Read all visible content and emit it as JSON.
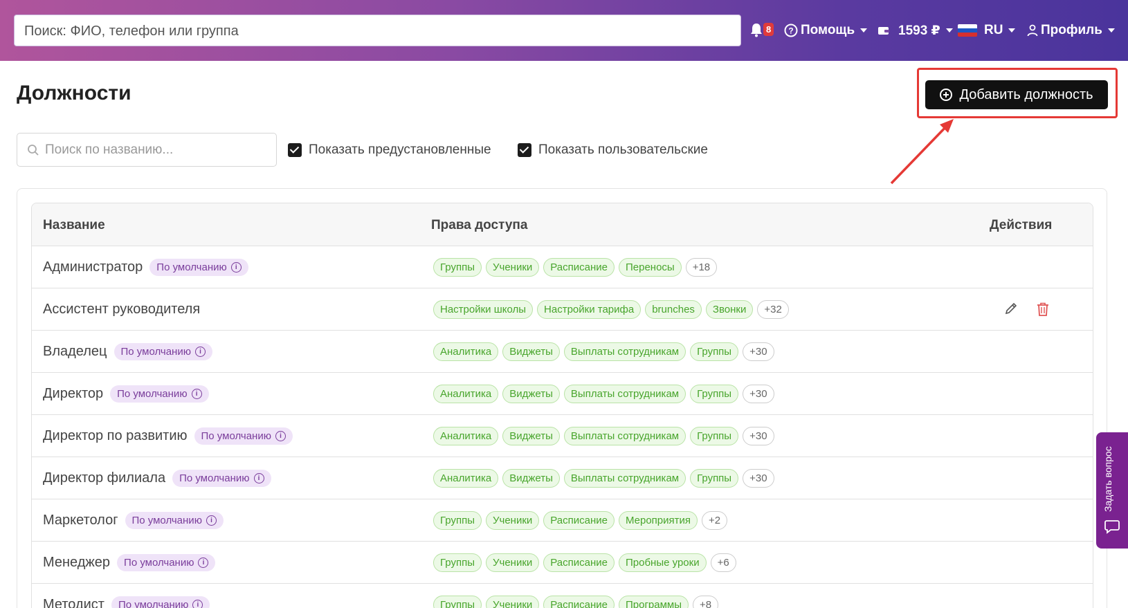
{
  "header": {
    "search_placeholder": "Поиск: ФИО, телефон или группа",
    "notifications_count": "8",
    "help_label": "Помощь",
    "balance": "1593 ₽",
    "language": "RU",
    "profile_label": "Профиль"
  },
  "page": {
    "title": "Должности",
    "add_button_label": "Добавить должность",
    "name_search_placeholder": "Поиск по названию...",
    "show_predefined_label": "Показать предустановленные",
    "show_custom_label": "Показать пользовательские"
  },
  "table": {
    "headers": {
      "name": "Название",
      "permissions": "Права доступа",
      "actions": "Действия"
    },
    "default_badge": "По умолчанию",
    "rows": [
      {
        "name": "Администратор",
        "default": true,
        "perms": [
          "Группы",
          "Ученики",
          "Расписание",
          "Переносы"
        ],
        "more": "+18"
      },
      {
        "name": "Ассистент руководителя",
        "default": false,
        "perms": [
          "Настройки школы",
          "Настройки тарифа",
          "brunches",
          "Звонки"
        ],
        "more": "+32"
      },
      {
        "name": "Владелец",
        "default": true,
        "perms": [
          "Аналитика",
          "Виджеты",
          "Выплаты сотрудникам",
          "Группы"
        ],
        "more": "+30"
      },
      {
        "name": "Директор",
        "default": true,
        "perms": [
          "Аналитика",
          "Виджеты",
          "Выплаты сотрудникам",
          "Группы"
        ],
        "more": "+30"
      },
      {
        "name": "Директор по развитию",
        "default": true,
        "perms": [
          "Аналитика",
          "Виджеты",
          "Выплаты сотрудникам",
          "Группы"
        ],
        "more": "+30"
      },
      {
        "name": "Директор филиала",
        "default": true,
        "perms": [
          "Аналитика",
          "Виджеты",
          "Выплаты сотрудникам",
          "Группы"
        ],
        "more": "+30"
      },
      {
        "name": "Маркетолог",
        "default": true,
        "perms": [
          "Группы",
          "Ученики",
          "Расписание",
          "Мероприятия"
        ],
        "more": "+2"
      },
      {
        "name": "Менеджер",
        "default": true,
        "perms": [
          "Группы",
          "Ученики",
          "Расписание",
          "Пробные уроки"
        ],
        "more": "+6"
      },
      {
        "name": "Методист",
        "default": true,
        "perms": [
          "Группы",
          "Ученики",
          "Расписание",
          "Программы"
        ],
        "more": "+8"
      }
    ]
  },
  "side_tab": {
    "label": "Задать вопрос"
  },
  "colors": {
    "accent": "#7a2290",
    "perm_green": "#48a52c",
    "badge_purple": "#7a3d9b",
    "highlight_red": "#e53935"
  }
}
